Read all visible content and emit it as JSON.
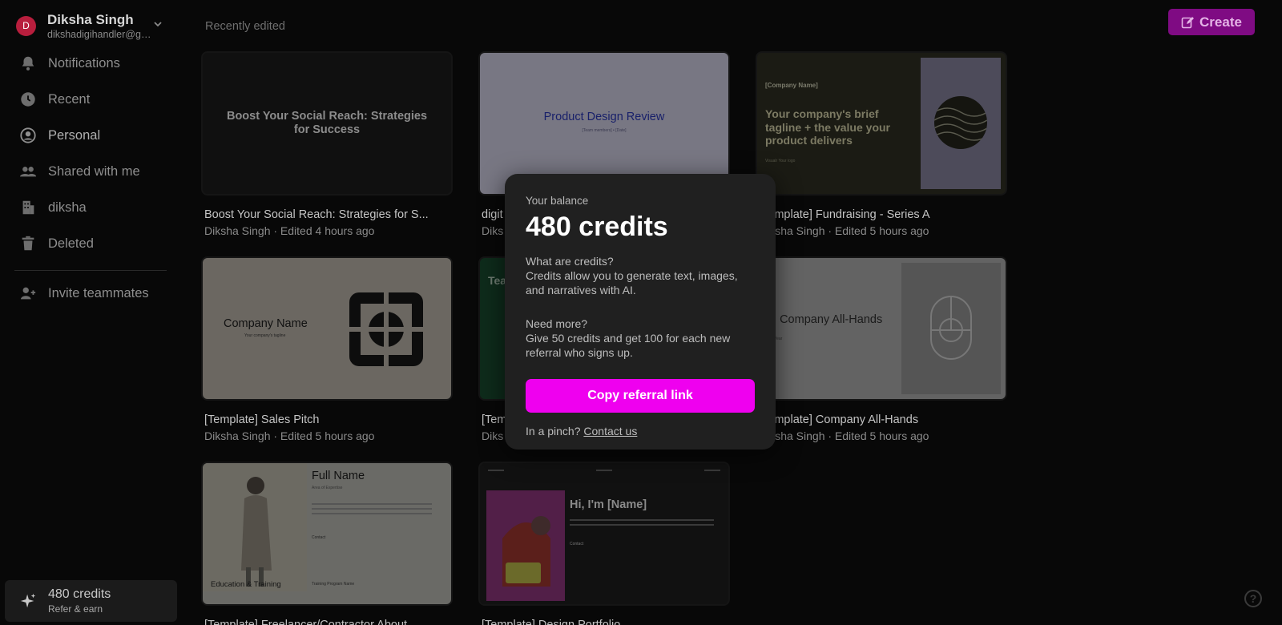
{
  "user": {
    "initial": "D",
    "name": "Diksha Singh",
    "email": "dikshadigihandler@gm..."
  },
  "sidebar": {
    "items": [
      {
        "label": "Notifications",
        "icon": "bell-icon"
      },
      {
        "label": "Recent",
        "icon": "clock-icon"
      },
      {
        "label": "Personal",
        "icon": "user-circle-icon"
      },
      {
        "label": "Shared with me",
        "icon": "users-icon"
      },
      {
        "label": "diksha",
        "icon": "building-icon"
      },
      {
        "label": "Deleted",
        "icon": "trash-icon"
      }
    ],
    "invite": {
      "label": "Invite teammates",
      "icon": "user-plus-icon"
    },
    "credits": {
      "label": "480 credits",
      "sub": "Refer & earn",
      "icon": "sparkle-icon"
    }
  },
  "header": {
    "section_title": "Recently edited",
    "create_label": "Create",
    "create_icon": "edit-icon"
  },
  "cards": [
    {
      "title": "Boost Your Social Reach: Strategies for S...",
      "meta": "Diksha Singh · Edited 4 hours ago",
      "thumb": {
        "heading": "Boost Your Social Reach: Strategies for Success"
      }
    },
    {
      "title": "digit",
      "meta": "Diks",
      "thumb": {
        "heading": "Product Design Review",
        "sub": "[Team members] • [Date]"
      }
    },
    {
      "title": "[Template] Fundraising - Series A",
      "meta": "Diksha Singh · Edited 5 hours ago",
      "thumb": {
        "company": "[Company Name]",
        "heading": "Your company's brief tagline + the value your product delivers",
        "sub": "Visualr Your logo"
      }
    },
    {
      "title": "[Template] Sales Pitch",
      "meta": "Diksha Singh · Edited 5 hours ago",
      "thumb": {
        "heading": "Company Name",
        "sub": "Your company's tagline"
      }
    },
    {
      "title": "[Tem",
      "meta": "Diks",
      "thumb": {
        "heading": "Tea"
      }
    },
    {
      "title": "[Template] Company All-Hands",
      "meta": "Diksha Singh · Edited 5 hours ago",
      "thumb": {
        "heading": "🏠 Company All-Hands",
        "sub": "Day, Year"
      }
    },
    {
      "title": "[Template] Freelancer/Contractor About ...",
      "meta": "",
      "thumb": {
        "heading": "Full Name",
        "sub": "Area of Expertise",
        "contact": "Contact",
        "program": "Training Program Name",
        "tag": "Education & Training"
      }
    },
    {
      "title": "[Template] Design Portfolio",
      "meta": "",
      "thumb": {
        "heading": "Hi, I'm [Name]",
        "contact": "Contact"
      }
    }
  ],
  "popup": {
    "label": "Your balance",
    "balance": "480 credits",
    "what_title": "What are credits?",
    "what_body": "Credits allow you to generate text, images, and narratives with AI.",
    "more_title": "Need more?",
    "more_body": "Give 50 credits and get 100 for each new referral who signs up.",
    "button": "Copy referral link",
    "foot_prefix": "In a pinch? ",
    "foot_link": "Contact us"
  },
  "help": {
    "label": "?",
    "icon": "help-icon"
  },
  "colors": {
    "accent": "#ef00ef",
    "create_bg": "#7f0b83",
    "avatar": "#b81e3d",
    "popup_bg": "#202020"
  }
}
